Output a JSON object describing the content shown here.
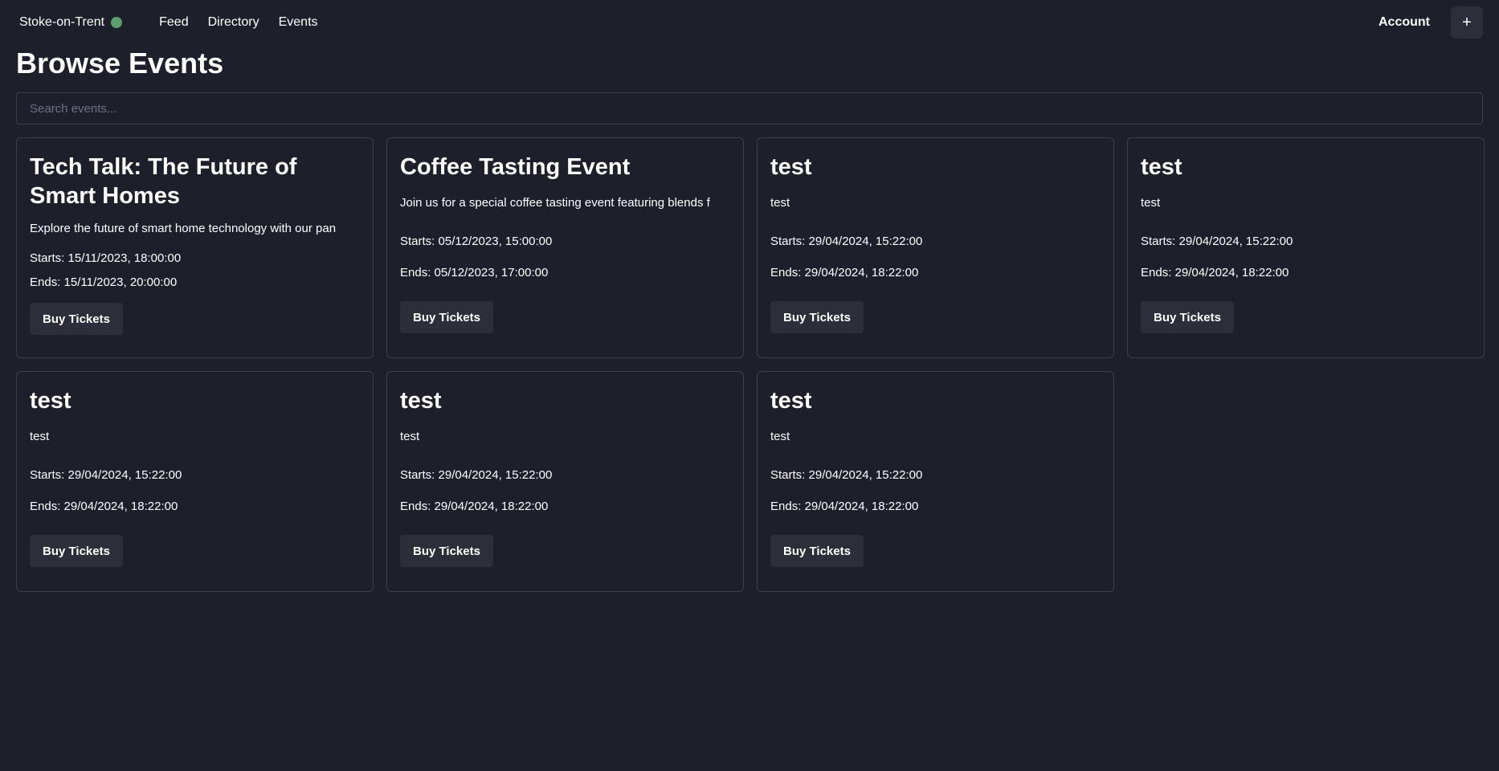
{
  "header": {
    "brand": "Stoke-on-Trent",
    "status_color": "#5c9e6e",
    "nav": [
      "Feed",
      "Directory",
      "Events"
    ],
    "account_label": "Account",
    "plus_label": "+"
  },
  "page_title": "Browse Events",
  "search": {
    "placeholder": "Search events..."
  },
  "events": [
    {
      "title": "Tech Talk: The Future of Smart Homes",
      "description": "Explore the future of smart home technology with our pan",
      "starts": "Starts: 15/11/2023, 18:00:00",
      "ends": "Ends: 15/11/2023, 20:00:00",
      "button": "Buy Tickets"
    },
    {
      "title": "Coffee Tasting Event",
      "description": "Join us for a special coffee tasting event featuring blends f",
      "starts": "Starts: 05/12/2023, 15:00:00",
      "ends": "Ends: 05/12/2023, 17:00:00",
      "button": "Buy Tickets"
    },
    {
      "title": "test",
      "description": "test",
      "starts": "Starts: 29/04/2024, 15:22:00",
      "ends": "Ends: 29/04/2024, 18:22:00",
      "button": "Buy Tickets"
    },
    {
      "title": "test",
      "description": "test",
      "starts": "Starts: 29/04/2024, 15:22:00",
      "ends": "Ends: 29/04/2024, 18:22:00",
      "button": "Buy Tickets"
    },
    {
      "title": "test",
      "description": "test",
      "starts": "Starts: 29/04/2024, 15:22:00",
      "ends": "Ends: 29/04/2024, 18:22:00",
      "button": "Buy Tickets"
    },
    {
      "title": "test",
      "description": "test",
      "starts": "Starts: 29/04/2024, 15:22:00",
      "ends": "Ends: 29/04/2024, 18:22:00",
      "button": "Buy Tickets"
    },
    {
      "title": "test",
      "description": "test",
      "starts": "Starts: 29/04/2024, 15:22:00",
      "ends": "Ends: 29/04/2024, 18:22:00",
      "button": "Buy Tickets"
    }
  ]
}
